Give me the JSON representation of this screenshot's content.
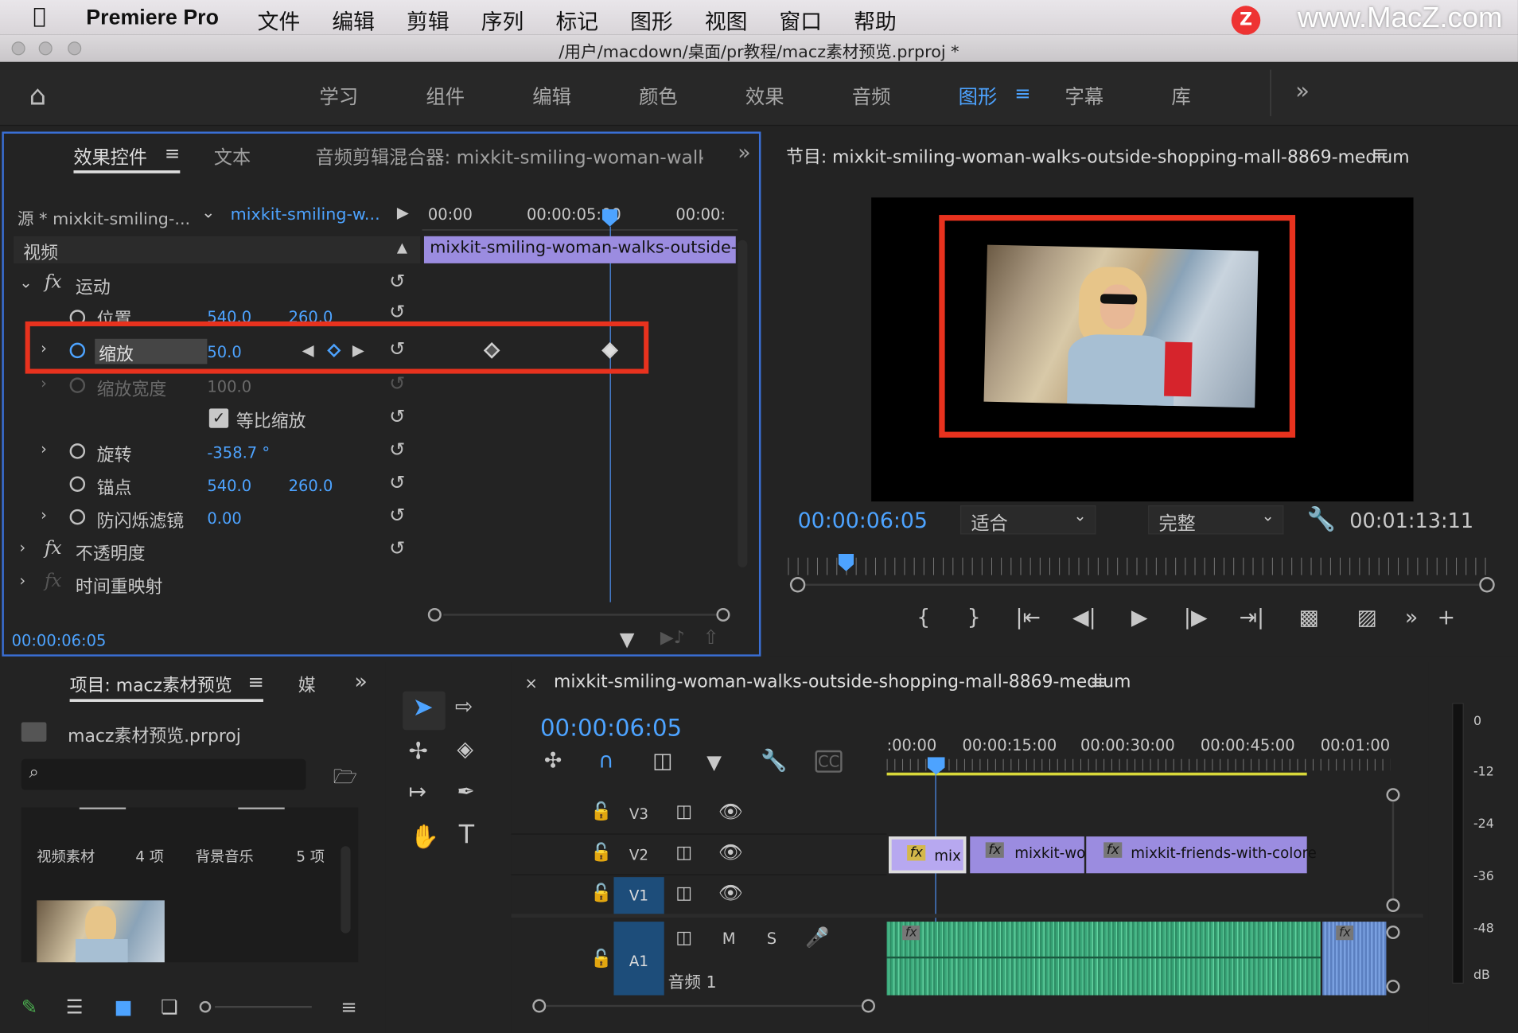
{
  "menubar": {
    "app": "Premiere Pro",
    "items": [
      "文件",
      "编辑",
      "剪辑",
      "序列",
      "标记",
      "图形",
      "视图",
      "窗口",
      "帮助"
    ],
    "watermark": "www.MacZ.com",
    "logo_letter": "Z"
  },
  "titlebar": {
    "path": "/用户/macdown/桌面/pr教程/macz素材预览.prproj *"
  },
  "workspaces": {
    "items": [
      "学习",
      "组件",
      "编辑",
      "颜色",
      "效果",
      "音频",
      "图形",
      "字幕",
      "库"
    ],
    "active": "图形",
    "more": "»"
  },
  "effect_controls": {
    "tabs": [
      "效果控件",
      "文本",
      "音频剪辑混合器: mixkit-smiling-woman-walks-c"
    ],
    "source": "源 * mixkit-smiling-...",
    "clip": "mixkit-smiling-w...",
    "ruler": [
      "00:00",
      "00:00:05:00",
      "00:00:"
    ],
    "clip_bar": "mixkit-smiling-woman-walks-outside-s",
    "section": "视频",
    "motion": "运动",
    "rows": {
      "position": {
        "label": "位置",
        "v1": "540.0",
        "v2": "260.0"
      },
      "scale": {
        "label": "缩放",
        "v1": "50.0"
      },
      "scale_width": {
        "label": "缩放宽度",
        "v1": "100.0"
      },
      "uniform": {
        "label": "等比缩放"
      },
      "rotation": {
        "label": "旋转",
        "v1": "-358.7 °"
      },
      "anchor": {
        "label": "锚点",
        "v1": "540.0",
        "v2": "260.0"
      },
      "antiflicker": {
        "label": "防闪烁滤镜",
        "v1": "0.00"
      }
    },
    "opacity": "不透明度",
    "timeremap": "时间重映射",
    "timecode": "00:00:06:05"
  },
  "program": {
    "title": "节目: mixkit-smiling-woman-walks-outside-shopping-mall-8869-medium",
    "timecode": "00:00:06:05",
    "fit": "适合",
    "quality": "完整",
    "duration": "00:01:13:11"
  },
  "project": {
    "tab": "项目: macz素材预览",
    "tab2": "媒",
    "file": "macz素材预览.prproj",
    "bins": [
      {
        "name": "视频素材",
        "count": "4 项"
      },
      {
        "name": "背景音乐",
        "count": "5 项"
      }
    ]
  },
  "timeline": {
    "title": "mixkit-smiling-woman-walks-outside-shopping-mall-8869-medium",
    "timecode": "00:00:06:05",
    "ruler": [
      ":00:00",
      "00:00:15:00",
      "00:00:30:00",
      "00:00:45:00",
      "00:01:00"
    ],
    "tracks": [
      "V3",
      "V2",
      "V1",
      "A1"
    ],
    "clips": [
      "mix",
      "mixkit-wo",
      "mixkit-friends-with-colore"
    ],
    "audio_label": "音频 1",
    "m": "M",
    "s": "S"
  },
  "meter": {
    "labels": [
      "0",
      "-12",
      "-24",
      "-36",
      "-48",
      "dB"
    ]
  }
}
